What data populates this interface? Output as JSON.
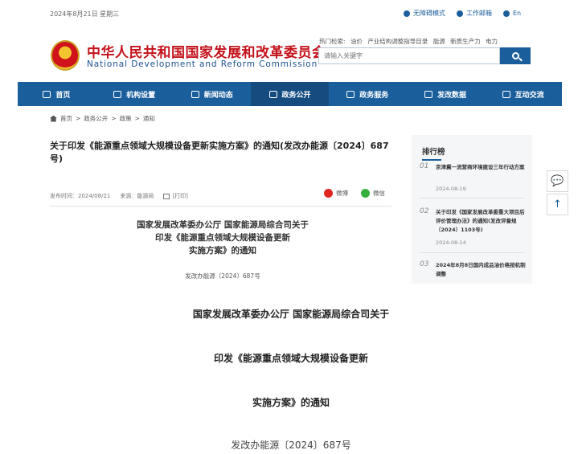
{
  "topbar": {
    "date": "2024年8月21日 星期三",
    "links": [
      {
        "label": "无障碍模式",
        "icon": "location-icon"
      },
      {
        "label": "工作邮箱",
        "icon": "mail-icon"
      },
      {
        "label": "En",
        "icon": "globe-icon"
      }
    ]
  },
  "header": {
    "name_cn": "中华人民共和国国家发展和改革委员会",
    "name_en": "National Development and Reform Commission",
    "hot_label": "热门检索:",
    "hot_terms": [
      "油价",
      "产业结构调整指导目录",
      "能源",
      "新质生产力",
      "电力"
    ],
    "search_placeholder": "请输入关键字"
  },
  "nav": {
    "items": [
      {
        "label": "首页",
        "icon": "home-icon"
      },
      {
        "label": "机构设置",
        "icon": "building-icon"
      },
      {
        "label": "新闻动态",
        "icon": "news-icon"
      },
      {
        "label": "政务公开",
        "icon": "umbrella-icon"
      },
      {
        "label": "政务服务",
        "icon": "service-icon"
      },
      {
        "label": "发改数据",
        "icon": "data-icon"
      },
      {
        "label": "互动交流",
        "icon": "chat-icon"
      }
    ],
    "active_index": 3
  },
  "breadcrumb": {
    "items": [
      "首页",
      "政务公开",
      "政策",
      "通知"
    ]
  },
  "article": {
    "title": "关于印发《能源重点领域大规模设备更新实施方案》的通知(发改办能源〔2024〕687号)",
    "publish_label": "发布时间：2024/08/21",
    "source_label": "来源：能源局",
    "print_label": "[打印]",
    "share_weibo": "微博",
    "share_wechat": "微信",
    "doc_title_lines": [
      "国家发展改革委办公厅 国家能源局综合司关于",
      "印发《能源重点领域大规模设备更新",
      "实施方案》的通知"
    ],
    "doc_number": "发改办能源〔2024〕687号"
  },
  "sidebar": {
    "title": "排行榜",
    "items": [
      {
        "num": "01",
        "title": "京津冀一流营商环境建设三年行动方案",
        "date": "2024-08-19"
      },
      {
        "num": "02",
        "title": "关于印发《国家发展改革委重大项目后评价管理办法》的通知(发改评督规〔2024〕1103号)",
        "date": "2024-08-14"
      },
      {
        "num": "03",
        "title": "2024年8月8日国内成品油价格按机制调整",
        "date": ""
      }
    ]
  },
  "float_buttons": [
    {
      "icon": "chat-bubble-icon",
      "glyph": "💬"
    },
    {
      "icon": "back-to-top-icon",
      "glyph": "↑"
    }
  ],
  "enlarged": {
    "lines": [
      "国家发展改革委办公厅 国家能源局综合司关于",
      "印发《能源重点领域大规模设备更新",
      "实施方案》的通知"
    ],
    "doc_number": "发改办能源〔2024〕687号"
  },
  "colors": {
    "brand_red": "#c3121b",
    "brand_blue": "#1a5e9c",
    "nav_active": "#144c80"
  }
}
